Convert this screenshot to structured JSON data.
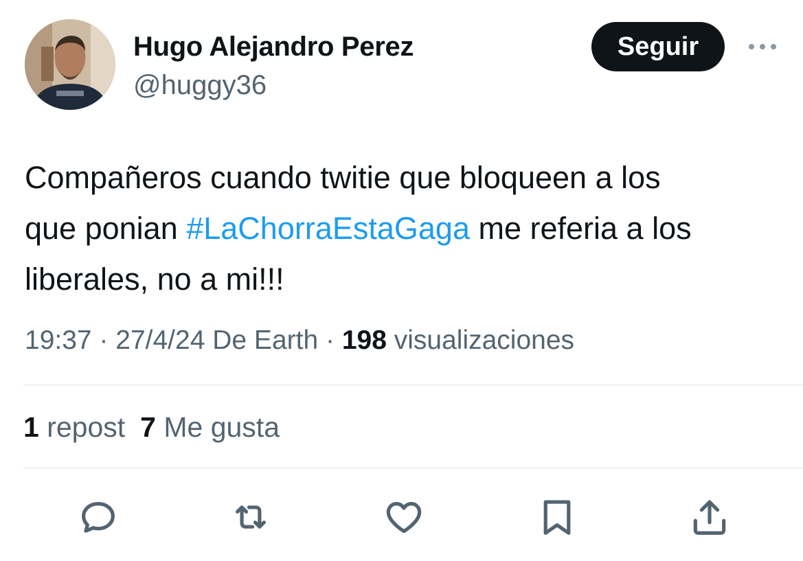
{
  "author": {
    "display_name": "Hugo Alejandro Perez",
    "handle": "@huggy36"
  },
  "header": {
    "follow_label": "Seguir",
    "more_icon": "more-horizontal-icon"
  },
  "tweet": {
    "text_line1": "Compañeros cuando twitie que bloqueen a los",
    "text_line2_before": "que ponian ",
    "hashtag": "#LaChorraEstaGaga",
    "text_line2_after": " me referia a los",
    "text_line3": "liberales, no a mi!!!",
    "hashtag_color": "#1d9bf0"
  },
  "meta": {
    "time": "19:37",
    "separator1": " · ",
    "date": "27/4/24",
    "source": " De Earth",
    "separator2": " · ",
    "views_count": "198",
    "views_label": " visualizaciones"
  },
  "stats": {
    "reposts_count": "1",
    "reposts_label": " repost",
    "likes_count": "7",
    "likes_label": " Me gusta"
  },
  "actions": [
    {
      "icon": "reply-icon"
    },
    {
      "icon": "repost-icon"
    },
    {
      "icon": "like-icon"
    },
    {
      "icon": "bookmark-icon"
    },
    {
      "icon": "share-icon"
    }
  ],
  "colors": {
    "text_primary": "#0f1419",
    "text_secondary": "#536471",
    "accent": "#1d9bf0",
    "divider": "#e1e6ea",
    "follow_button_bg": "#0f1419"
  }
}
